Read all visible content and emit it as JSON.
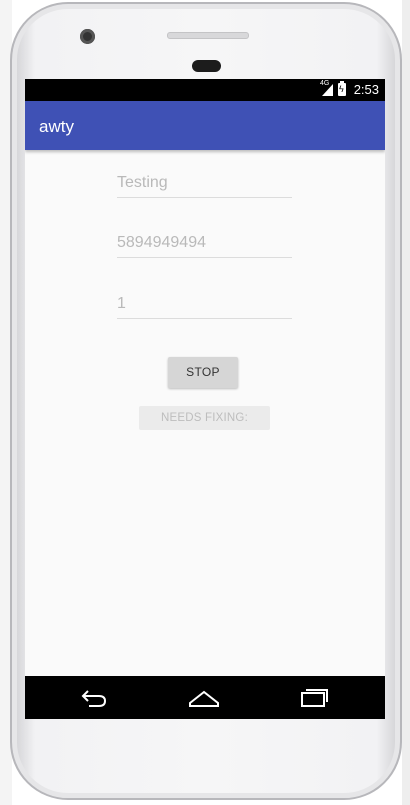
{
  "app": {
    "title": "awty"
  },
  "status_bar": {
    "time": "2:53",
    "network": "4G"
  },
  "form": {
    "message_value": "Testing",
    "phone_value": "5894949494",
    "interval_value": "1"
  },
  "buttons": {
    "stop_label": "STOP",
    "needs_fixing_label": "NEEDS FIXING:"
  },
  "navigation": {
    "back_icon": "back-icon",
    "home_icon": "home-icon",
    "recent_icon": "recent-apps-icon"
  },
  "colors": {
    "app_bar": "#3f51b5",
    "screen_background": "#fafafa",
    "button": "#d6d6d6"
  }
}
